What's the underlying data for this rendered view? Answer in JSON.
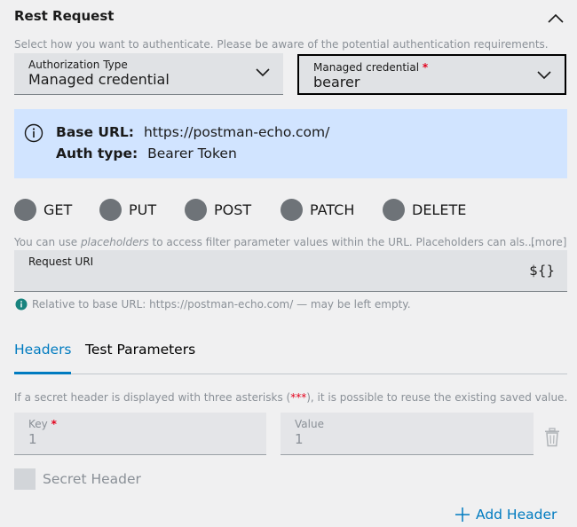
{
  "header": {
    "title": "Rest Request"
  },
  "auth": {
    "hint": "Select how you want to authenticate. Please be aware of the potential authentication requirements.",
    "type_label": "Authorization Type",
    "type_value": "Managed credential",
    "credential_label": "Managed credential",
    "credential_required": "*",
    "credential_value": "bearer"
  },
  "info": {
    "base_url_label": "Base URL:",
    "base_url_value": "https://postman-echo.com/",
    "auth_type_label": "Auth type:",
    "auth_type_value": "Bearer Token"
  },
  "methods": [
    "GET",
    "PUT",
    "POST",
    "PATCH",
    "DELETE"
  ],
  "uri": {
    "hint_prefix": "You can use ",
    "hint_em": "placeholders",
    "hint_suffix": " to access filter parameter values within the URL. Placeholders can als...",
    "more": "[more]",
    "label": "Request URI",
    "placeholder_button": "${}",
    "relative_hint": "Relative to base URL: https://postman-echo.com/ — may be left empty."
  },
  "tabs": {
    "headers": "Headers",
    "test_parameters": "Test Parameters"
  },
  "headers": {
    "hint_prefix": "If a secret header is displayed with three asterisks (",
    "hint_asterisks": "***",
    "hint_suffix": "), it is possible to reuse the existing saved value.",
    "key_label": "Key",
    "key_required": "*",
    "key_value": "1",
    "value_label": "Value",
    "value_value": "1",
    "secret_label": "Secret Header",
    "add_label": "Add Header"
  }
}
